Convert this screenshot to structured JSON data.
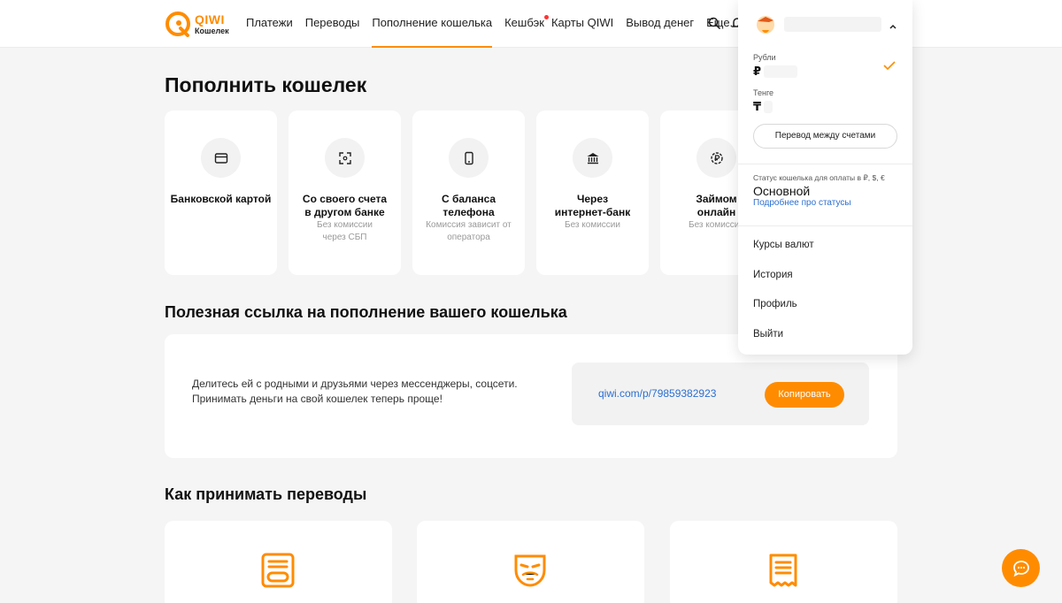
{
  "header": {
    "logo": {
      "brand": "QIWI",
      "subtitle": "Кошелек"
    },
    "nav": [
      "Платежи",
      "Переводы",
      "Пополнение кошелька",
      "Кешбэк",
      "Карты QIWI",
      "Вывод денег",
      "Еще..."
    ],
    "active_nav": "Пополнение кошелька",
    "icons": [
      "search-icon",
      "bell-icon"
    ]
  },
  "main": {
    "title": "Пополнить кошелек",
    "methods": [
      {
        "title": "Банковской картой",
        "sub": "",
        "icon": "card-icon"
      },
      {
        "title": "Со своего счета в другом банке",
        "sub": "Без комиссии через СБП",
        "icon": "sbp-icon"
      },
      {
        "title": "С баланса телефона",
        "sub": "Комиссия зависит от оператора",
        "icon": "phone-icon"
      },
      {
        "title": "Через интернет-банк",
        "sub": "Без комиссии",
        "icon": "bank-icon"
      },
      {
        "title": "Займом онлайн",
        "sub": "Без комиссии",
        "icon": "ruble-coin-icon"
      }
    ],
    "link_section": {
      "title": "Полезная ссылка на пополнение вашего кошелька",
      "line1": "Делитесь ей с родными и друзьями через мессенджеры, соцсети.",
      "line2": "Принимать деньги на свой кошелек теперь проще!",
      "link": "qiwi.com/p/79859382923",
      "copy_label": "Копировать"
    },
    "receive_title": "Как принимать переводы"
  },
  "dropdown": {
    "accounts": [
      {
        "label": "Рубли",
        "symbol": "₽",
        "selected": true
      },
      {
        "label": "Тенге",
        "symbol": "₸",
        "selected": false
      }
    ],
    "transfer_label": "Перевод между счетами",
    "status_label": "Статус кошелька для оплаты в ₽, $, €",
    "status_value": "Основной",
    "status_link": "Подробнее про статусы",
    "menu": [
      "Курсы валют",
      "История",
      "Профиль",
      "Выйти"
    ]
  },
  "colors": {
    "accent": "#ff8c00",
    "link": "#2b6fd1",
    "background": "#f5f5f5"
  }
}
